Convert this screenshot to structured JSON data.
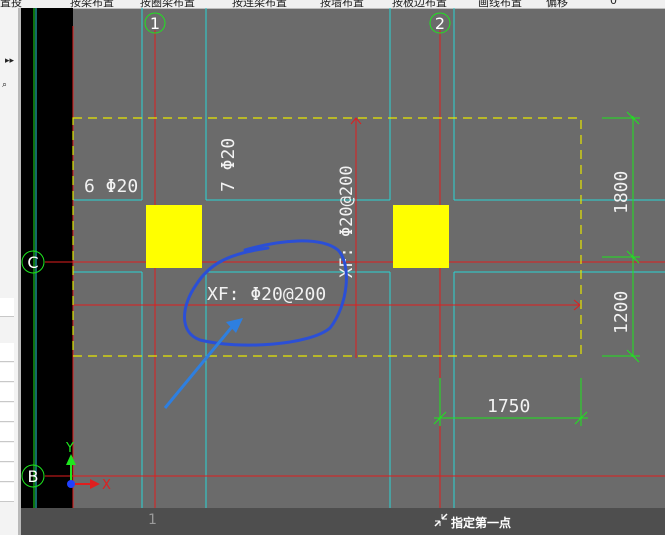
{
  "toolbar": {
    "items": [
      "置投",
      "按梁布置",
      "按圈梁布置",
      "按连梁布置",
      "按墙布置",
      "按板边布置",
      "画线布置",
      "偏移",
      "0"
    ]
  },
  "drawing": {
    "axis_labels": {
      "col1": "1",
      "col2": "2",
      "rowC": "C",
      "rowB": "B"
    },
    "rebar_labels": {
      "left": "6 Φ20",
      "mid": "7 Φ20",
      "vertical": "XF: Φ20@200",
      "horizontal": "XF: Φ20@200"
    },
    "dimensions": {
      "d1800": "1800",
      "d1200": "1200",
      "d1750": "1750"
    },
    "ucs": {
      "x": "X",
      "y": "Y"
    },
    "colors": {
      "background": "#6b6b6b",
      "axis": "#e01e1e",
      "wall": "#29d4d4",
      "column": "#ffff00",
      "dashed": "#e6e600",
      "dimension": "#1ee61e",
      "annotation": "#2b4fd6"
    }
  },
  "status": {
    "prompt": "指定第一点",
    "axis_ghost": "1"
  }
}
